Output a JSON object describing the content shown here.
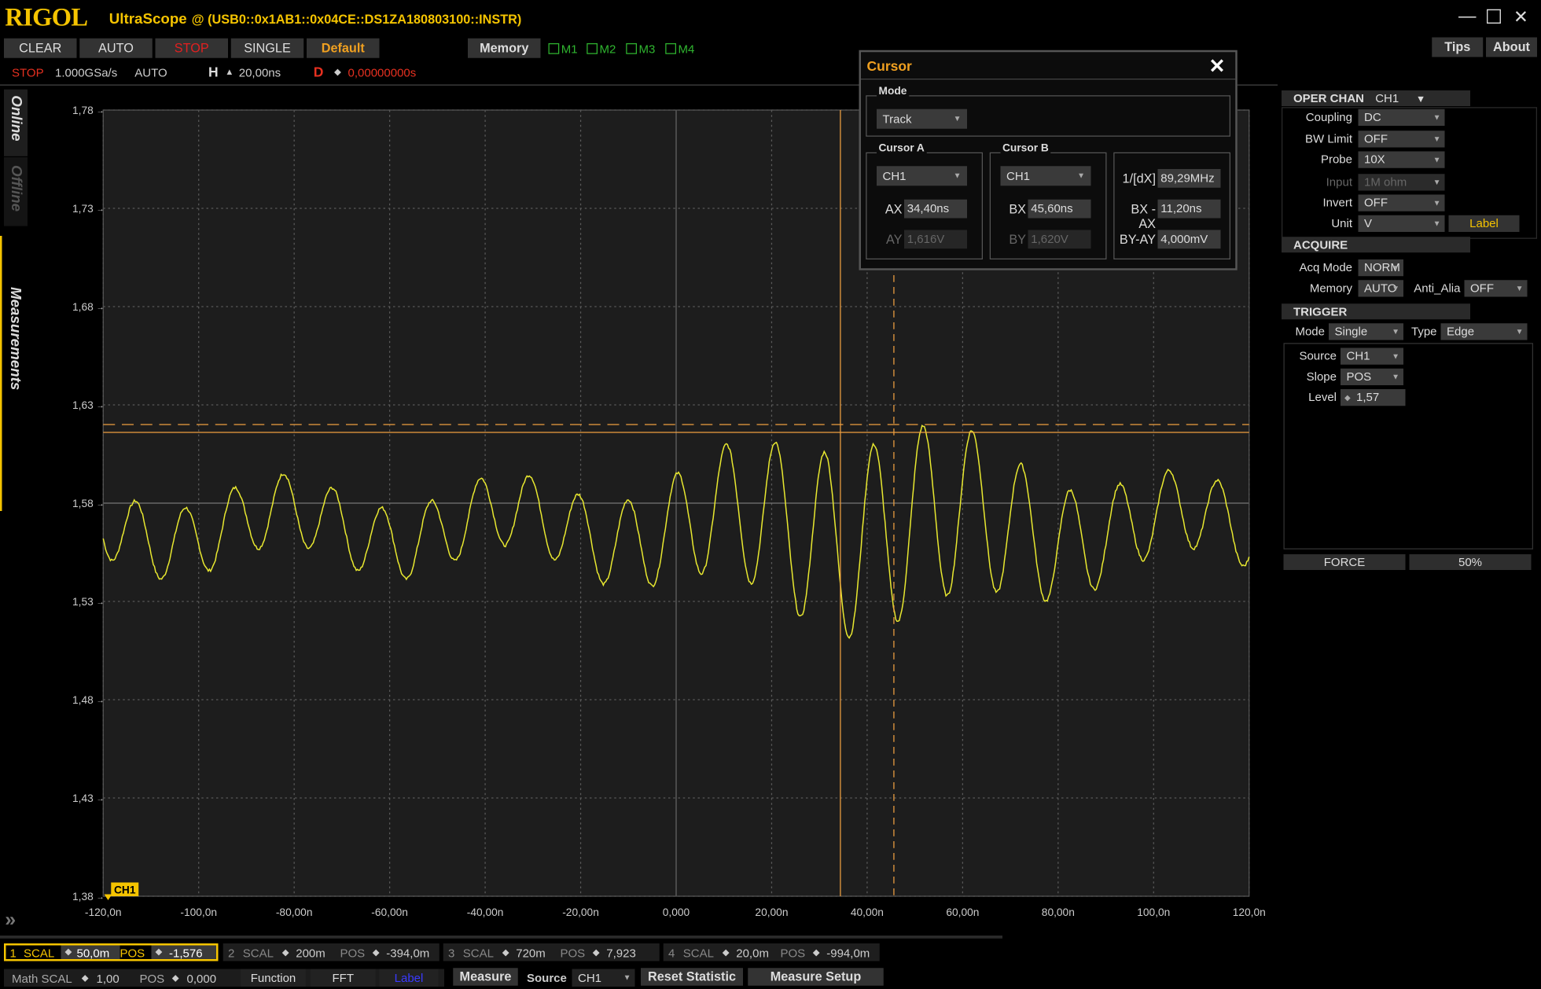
{
  "titlebar": {
    "logo": "RIGOL",
    "app_name": "UltraScope",
    "instrument": "@ (USB0::0x1AB1::0x04CE::DS1ZA180803100::INSTR)",
    "minimize": "—",
    "maximize": "☐",
    "close": "✕"
  },
  "toolbar": {
    "clear": "CLEAR",
    "auto": "AUTO",
    "stop": "STOP",
    "single": "SINGLE",
    "default": "Default",
    "memory": "Memory",
    "m1": "M1",
    "m2": "M2",
    "m3": "M3",
    "m4": "M4",
    "tips": "Tips",
    "about": "About"
  },
  "status": {
    "run_state": "STOP",
    "sample_rate": "1.000GSa/s",
    "trigger_mode": "AUTO",
    "h_label": "H",
    "h_value": "20,00ns",
    "d_label": "D",
    "d_value": "0,00000000s"
  },
  "sidetabs": {
    "online": "Online",
    "offline": "Offline",
    "measurements": "Measurements",
    "expand": "»"
  },
  "plot": {
    "y_ticks": [
      "1,78",
      "1,73",
      "1,68",
      "1,63",
      "1,58",
      "1,53",
      "1,48",
      "1,43",
      "1,38"
    ],
    "x_ticks": [
      "-120,0n",
      "-100,0n",
      "-80,00n",
      "-60,00n",
      "-40,00n",
      "-20,00n",
      "0,000",
      "20,00n",
      "40,00n",
      "60,00n",
      "80,00n",
      "100,0n",
      "120,0n"
    ],
    "ch_marker": "CH1",
    "colors": {
      "trace": "#e8e830",
      "cursor": "#f0a040",
      "grid": "#5a5a5a",
      "bg": "#1d1d1d"
    },
    "cursor_a_x_ns": 34.4,
    "cursor_b_x_ns": 45.6,
    "cursor_a_y_v": 1.616,
    "cursor_b_y_v": 1.62,
    "trigger_level_v": 1.57
  },
  "cursor_dialog": {
    "title": "Cursor",
    "close": "✕",
    "mode_group": "Mode",
    "mode_value": "Track",
    "cursor_a_group": "Cursor A",
    "cursor_b_group": "Cursor B",
    "a_source": "CH1",
    "b_source": "CH1",
    "ax_label": "AX",
    "ax_value": "34,40ns",
    "ay_label": "AY",
    "ay_value": "1,616V",
    "bx_label": "BX",
    "bx_value": "45,60ns",
    "by_label": "BY",
    "by_value": "1,620V",
    "inv_dx_label": "1/[dX]",
    "inv_dx_value": "89,29MHz",
    "bx_ax_label": "BX -AX",
    "bx_ax_value": "11,20ns",
    "by_ay_label": "BY-AY",
    "by_ay_value": "4,000mV"
  },
  "right_panel": {
    "oper_chan_label": "OPER CHAN",
    "oper_chan_value": "CH1",
    "coupling_label": "Coupling",
    "coupling_value": "DC",
    "bw_label": "BW Limit",
    "bw_value": "OFF",
    "probe_label": "Probe",
    "probe_value": "10X",
    "input_label": "Input",
    "input_value": "1M ohm",
    "invert_label": "Invert",
    "invert_value": "OFF",
    "unit_label": "Unit",
    "unit_value": "V",
    "label_button": "Label",
    "acquire_header": "ACQUIRE",
    "acq_mode_label": "Acq Mode",
    "acq_mode_value": "NORM",
    "memory_label": "Memory",
    "memory_value": "AUTO",
    "anti_alias_label": "Anti_Alia",
    "anti_alias_value": "OFF",
    "trigger_header": "TRIGGER",
    "trig_mode_label": "Mode",
    "trig_mode_value": "Single",
    "type_label": "Type",
    "type_value": "Edge",
    "source_label": "Source",
    "source_value": "CH1",
    "slope_label": "Slope",
    "slope_value": "POS",
    "level_label": "Level",
    "level_value": "1,57",
    "force_button": "FORCE",
    "fifty_button": "50%"
  },
  "bottom": {
    "ch1": {
      "num": "1",
      "scal_label": "SCAL",
      "scal": "50,0m",
      "pos_label": "POS",
      "pos": "-1,576"
    },
    "ch2": {
      "num": "2",
      "scal_label": "SCAL",
      "scal": "200m",
      "pos_label": "POS",
      "pos": "-394,0m"
    },
    "ch3": {
      "num": "3",
      "scal_label": "SCAL",
      "scal": "720m",
      "pos_label": "POS",
      "pos": "7,923"
    },
    "ch4": {
      "num": "4",
      "scal_label": "SCAL",
      "scal": "20,0m",
      "pos_label": "POS",
      "pos": "-994,0m"
    },
    "math_label": "Math SCAL",
    "math_scal": "1,00",
    "math_pos_label": "POS",
    "math_pos": "0,000",
    "function": "Function",
    "fft": "FFT",
    "label": "Label",
    "measure": "Measure",
    "source_label": "Source",
    "source_value": "CH1",
    "reset_statistic": "Reset  Statistic",
    "measure_setup": "Measure Setup"
  }
}
